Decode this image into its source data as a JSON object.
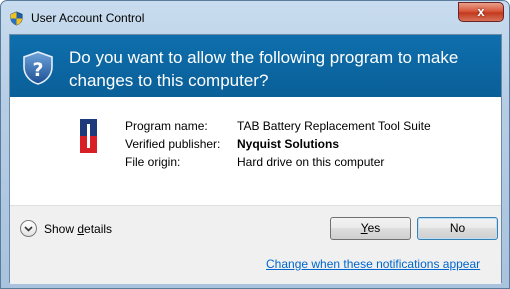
{
  "window": {
    "title": "User Account Control",
    "close_label": "x"
  },
  "header": {
    "question": "Do you want to allow the following program to make changes to this computer?"
  },
  "program_info": {
    "program_name_label": "Program name:",
    "program_name_value": "TAB Battery Replacement Tool Suite",
    "publisher_label": "Verified publisher:",
    "publisher_value": "Nyquist Solutions",
    "origin_label": "File origin:",
    "origin_value": "Hard drive on this computer"
  },
  "footer": {
    "details_prefix": "Show ",
    "details_accel": "d",
    "details_suffix": "etails",
    "yes_accel": "Y",
    "yes_rest": "es",
    "no_label": "No",
    "notifications_link": "Change when these notifications appear"
  },
  "colors": {
    "header_bg": "#0a5f98",
    "link": "#0066cc",
    "close_red": "#c23a1f"
  },
  "icons": [
    "uac-shield-icon",
    "question-shield-icon",
    "program-icon",
    "chevron-down-icon"
  ]
}
